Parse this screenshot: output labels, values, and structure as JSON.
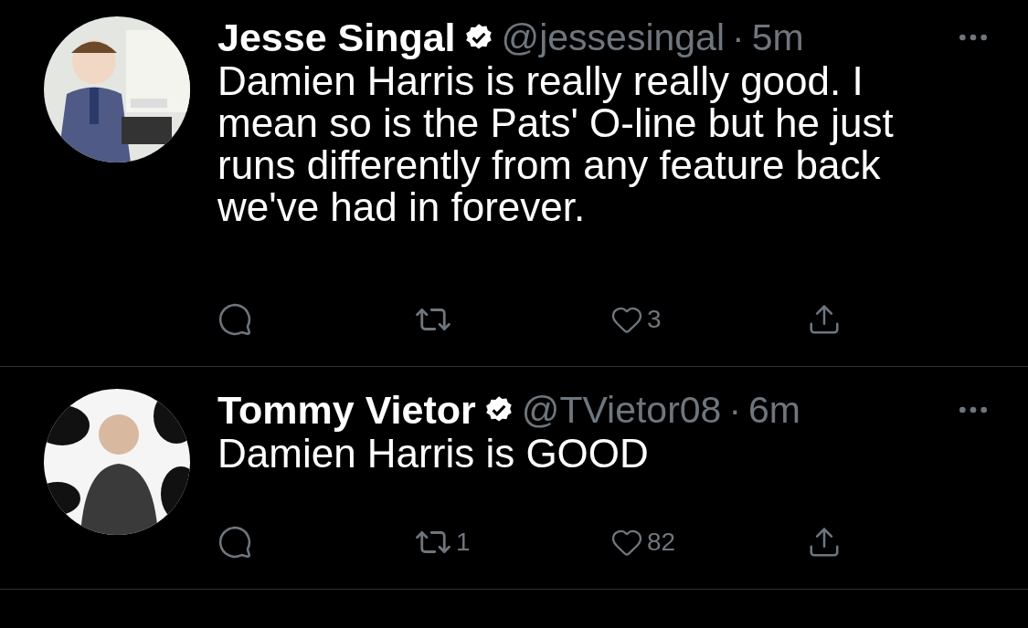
{
  "tweets": [
    {
      "name": "Jesse Singal",
      "verified": true,
      "handle": "@jessesingal",
      "separator": "·",
      "time": "5m",
      "text": "Damien Harris is really really good. I mean so is the Pats' O-line but he just runs differently from any feature back we've had in forever.",
      "likes": "3"
    },
    {
      "name": "Tommy Vietor",
      "verified": true,
      "handle": "@TVietor08",
      "separator": "·",
      "time": "6m",
      "text": "Damien Harris is GOOD",
      "retweets": "1",
      "likes": "82"
    }
  ]
}
